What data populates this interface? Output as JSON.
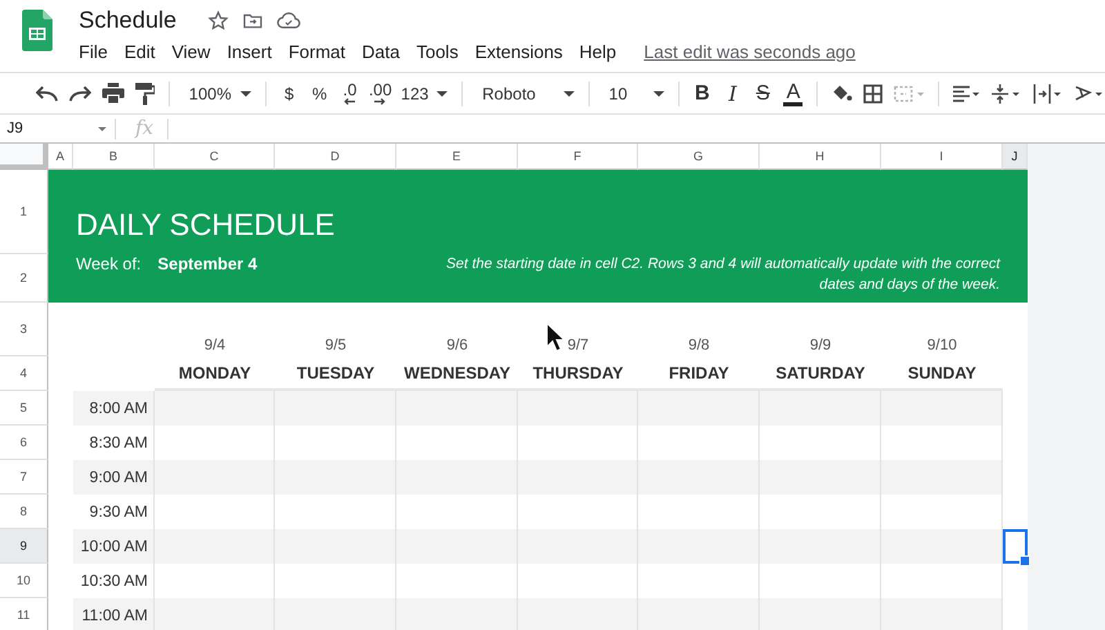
{
  "app": {
    "title": "Schedule",
    "menus": [
      "File",
      "Edit",
      "View",
      "Insert",
      "Format",
      "Data",
      "Tools",
      "Extensions",
      "Help"
    ],
    "last_edit": "Last edit was seconds ago"
  },
  "toolbar": {
    "zoom": "100%",
    "number_buttons": [
      "$",
      "%",
      ".0",
      ".00"
    ],
    "number_format": "123",
    "font": "Roboto",
    "font_size": "10",
    "text_buttons": [
      {
        "kind": "bold",
        "label": "B"
      },
      {
        "kind": "italic",
        "label": "I"
      },
      {
        "kind": "strike",
        "label": "S"
      },
      {
        "kind": "color",
        "label": "A"
      }
    ],
    "merge": {
      "disabled": true
    }
  },
  "formula_bar": {
    "cell": "J9",
    "fx": "fx"
  },
  "sheet": {
    "columns": [
      {
        "label": "A",
        "selected": false
      },
      {
        "label": "B",
        "selected": false
      },
      {
        "label": "C",
        "selected": false
      },
      {
        "label": "D",
        "selected": false
      },
      {
        "label": "E",
        "selected": false
      },
      {
        "label": "F",
        "selected": false
      },
      {
        "label": "G",
        "selected": false
      },
      {
        "label": "H",
        "selected": false
      },
      {
        "label": "I",
        "selected": false
      },
      {
        "label": "J",
        "selected": true
      }
    ],
    "rows": [
      {
        "label": "1",
        "selected": false
      },
      {
        "label": "2",
        "selected": false
      },
      {
        "label": "3",
        "selected": false
      },
      {
        "label": "4",
        "selected": false
      },
      {
        "label": "5",
        "selected": false
      },
      {
        "label": "6",
        "selected": false
      },
      {
        "label": "7",
        "selected": false
      },
      {
        "label": "8",
        "selected": false
      },
      {
        "label": "9",
        "selected": true
      },
      {
        "label": "10",
        "selected": false
      },
      {
        "label": "11",
        "selected": false
      }
    ]
  },
  "banner": {
    "title": "DAILY SCHEDULE",
    "week_label": "Week of:",
    "week_value": "September 4",
    "note": "Set the starting date in cell C2. Rows 3 and 4 will automatically update with the correct dates and days of the week."
  },
  "days": [
    {
      "date": "9/4",
      "name": "MONDAY"
    },
    {
      "date": "9/5",
      "name": "TUESDAY"
    },
    {
      "date": "9/6",
      "name": "WEDNESDAY"
    },
    {
      "date": "9/7",
      "name": "THURSDAY"
    },
    {
      "date": "9/8",
      "name": "FRIDAY"
    },
    {
      "date": "9/9",
      "name": "SATURDAY"
    },
    {
      "date": "9/10",
      "name": "SUNDAY"
    }
  ],
  "times": [
    "8:00 AM",
    "8:30 AM",
    "9:00 AM",
    "9:30 AM",
    "10:00 AM",
    "10:30 AM",
    "11:00 AM"
  ]
}
